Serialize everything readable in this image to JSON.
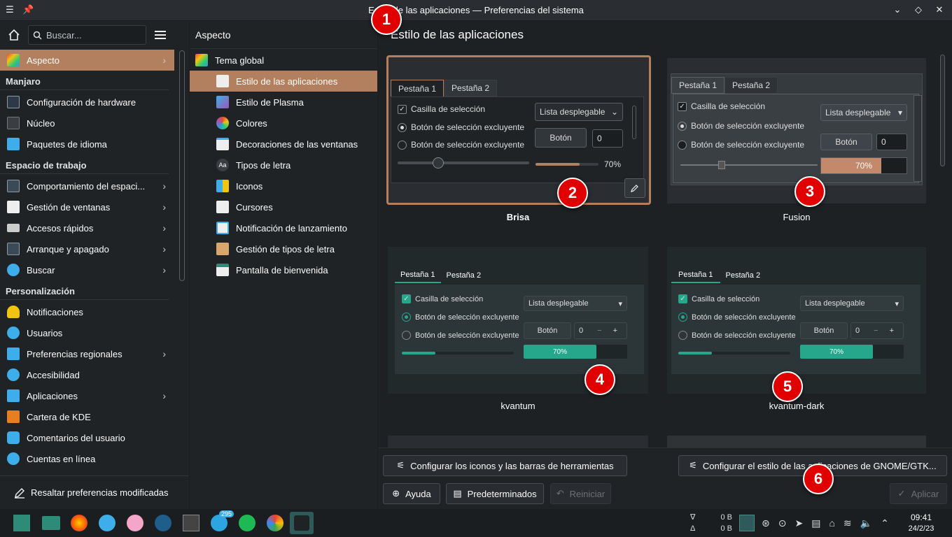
{
  "window": {
    "title": "Estilo de las aplicaciones — Preferencias del sistema"
  },
  "sidebar": {
    "search_placeholder": "Buscar...",
    "top_item": "Aspecto",
    "sections": [
      {
        "title": "Manjaro",
        "items": [
          "Configuración de hardware",
          "Núcleo",
          "Paquetes de idioma"
        ]
      },
      {
        "title": "Espacio de trabajo",
        "items": [
          "Comportamiento del espaci...",
          "Gestión de ventanas",
          "Accesos rápidos",
          "Arranque y apagado",
          "Buscar"
        ]
      },
      {
        "title": "Personalización",
        "items": [
          "Notificaciones",
          "Usuarios",
          "Preferencias regionales",
          "Accesibilidad",
          "Aplicaciones",
          "Cartera de KDE",
          "Comentarios del usuario",
          "Cuentas en línea"
        ]
      }
    ],
    "footer": "Resaltar preferencias modificadas"
  },
  "middle": {
    "title": "Aspecto",
    "top": "Tema global",
    "items": [
      "Estilo de las aplicaciones",
      "Estilo de Plasma",
      "Colores",
      "Decoraciones de las ventanas",
      "Tipos de letra",
      "Iconos",
      "Cursores",
      "Notificación de lanzamiento",
      "Gestión de tipos de letra",
      "Pantalla de bienvenida"
    ]
  },
  "main": {
    "title": "Estilo de las aplicaciones",
    "preview": {
      "tab1": "Pestaña 1",
      "tab2": "Pestaña 2",
      "checkbox": "Casilla de selección",
      "radio1": "Botón de selección excluyente",
      "radio2": "Botón de selección excluyente",
      "combo": "Lista desplegable",
      "button": "Botón",
      "spin": "0",
      "percent": "70%"
    },
    "styles": [
      "Brisa",
      "Fusion",
      "kvantum",
      "kvantum-dark"
    ],
    "buttons": {
      "icons_toolbars": "Configurar los iconos y las barras de herramientas",
      "gtk": "Configurar el estilo de las aplicaciones de GNOME/GTK...",
      "help": "Ayuda",
      "defaults": "Predeterminados",
      "reset": "Reiniciar",
      "apply": "Aplicar"
    }
  },
  "badges": [
    "1",
    "2",
    "3",
    "4",
    "5",
    "6"
  ],
  "taskbar": {
    "badge_count": "295",
    "net_down": "0 B",
    "net_up": "0 B",
    "time": "09:41",
    "date": "24/2/23"
  },
  "colors": {
    "accent": "#b3805f",
    "kvantum_accent": "#26a78b",
    "badge": "#e00000"
  }
}
